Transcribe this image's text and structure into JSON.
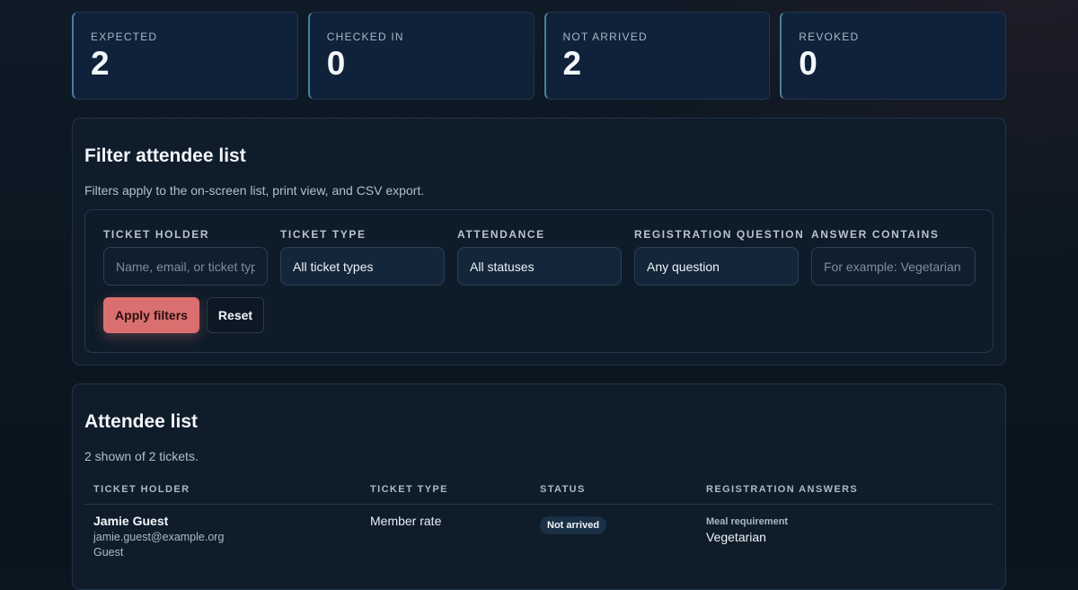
{
  "stats": [
    {
      "label": "Expected",
      "value": "2"
    },
    {
      "label": "Checked in",
      "value": "0"
    },
    {
      "label": "Not arrived",
      "value": "2"
    },
    {
      "label": "Revoked",
      "value": "0"
    }
  ],
  "filters": {
    "title": "Filter attendee list",
    "subtitle": "Filters apply to the on-screen list, print view, and CSV export.",
    "ticket_holder": {
      "label": "Ticket holder",
      "placeholder": "Name, email, or ticket type"
    },
    "ticket_type": {
      "label": "Ticket type",
      "value": "All ticket types"
    },
    "attendance": {
      "label": "Attendance",
      "value": "All statuses"
    },
    "registration_question": {
      "label": "Registration question",
      "value": "Any question"
    },
    "answer_contains": {
      "label": "Answer contains",
      "placeholder": "For example: Vegetarian"
    },
    "apply_label": "Apply filters",
    "reset_label": "Reset"
  },
  "attendees": {
    "title": "Attendee list",
    "count_text": "2 shown of 2 tickets.",
    "columns": [
      "Ticket holder",
      "Ticket type",
      "Status",
      "Registration answers"
    ],
    "rows": [
      {
        "name": "Jamie Guest",
        "email": "jamie.guest@example.org",
        "role": "Guest",
        "ticket_type": "Member rate",
        "status": "Not arrived",
        "answer_question": "Meal requirement",
        "answer_value": "Vegetarian"
      }
    ]
  },
  "colors": {
    "accent": "#d9706f",
    "panel": "#0f1c2a",
    "stat_card": "#10213a"
  }
}
